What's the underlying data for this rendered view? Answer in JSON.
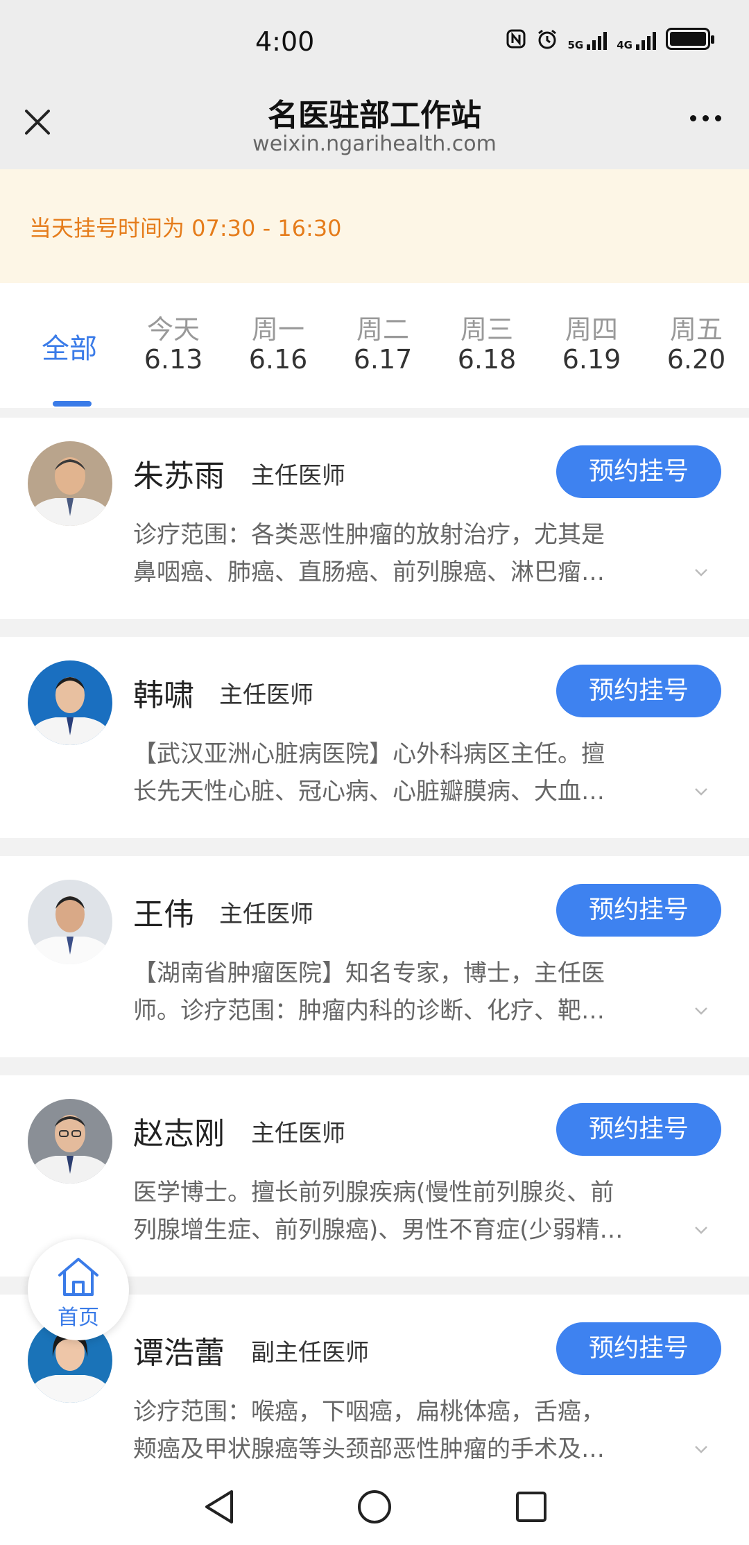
{
  "status": {
    "time": "4:00",
    "net1": "5G",
    "net2": "4G"
  },
  "nav": {
    "title": "名医驻部工作站",
    "subtitle": "weixin.ngarihealth.com"
  },
  "notice": {
    "text": "当天挂号时间为 07:30 - 16:30"
  },
  "tabs": {
    "all": "全部",
    "days": [
      {
        "weekday": "今天",
        "date": "6.13"
      },
      {
        "weekday": "周一",
        "date": "6.16"
      },
      {
        "weekday": "周二",
        "date": "6.17"
      },
      {
        "weekday": "周三",
        "date": "6.18"
      },
      {
        "weekday": "周四",
        "date": "6.19"
      },
      {
        "weekday": "周五",
        "date": "6.20"
      }
    ]
  },
  "doctors": [
    {
      "name": "朱苏雨",
      "title": "主任医师",
      "button": "预约挂号",
      "line1": "诊疗范围：各类恶性肿瘤的放射治疗，尤其是",
      "line2": "鼻咽癌、肺癌、直肠癌、前列腺癌、淋巴瘤…"
    },
    {
      "name": "韩啸",
      "title": "主任医师",
      "button": "预约挂号",
      "line1": "【武汉亚洲心脏病医院】心外科病区主任。擅",
      "line2": "长先天性心脏、冠心病、心脏瓣膜病、大血…"
    },
    {
      "name": "王伟",
      "title": "主任医师",
      "button": "预约挂号",
      "line1": "【湖南省肿瘤医院】知名专家，博士，主任医",
      "line2": "师。诊疗范围：肿瘤内科的诊断、化疗、靶…"
    },
    {
      "name": "赵志刚",
      "title": "主任医师",
      "button": "预约挂号",
      "line1": "医学博士。擅长前列腺疾病(慢性前列腺炎、前",
      "line2": "列腺增生症、前列腺癌)、男性不育症(少弱精…"
    },
    {
      "name": "谭浩蕾",
      "title": "副主任医师",
      "button": "预约挂号",
      "line1": "诊疗范围：喉癌，下咽癌，扁桃体癌，舌癌，",
      "line2": "颊癌及甲状腺癌等头颈部恶性肿瘤的手术及…"
    }
  ],
  "home": {
    "label": "首页"
  },
  "colors": {
    "accent": "#3a7be8",
    "button": "#3e82f0",
    "notice_bg": "#fdf6e6",
    "notice_text": "#e57c1b"
  }
}
